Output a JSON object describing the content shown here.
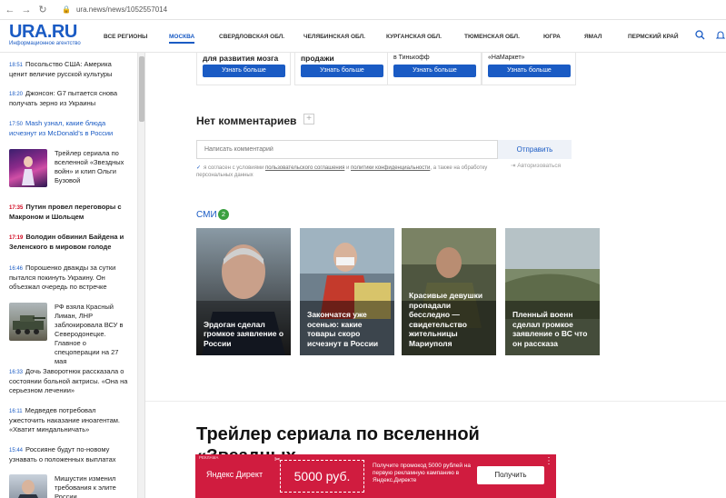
{
  "browser": {
    "url": "ura.news/news/1052557014"
  },
  "header": {
    "logo": "URA.RU",
    "logo_sub": "Информационное агентство",
    "nav": [
      "ВСЕ РЕГИОНЫ",
      "МОСКВА",
      "СВЕРДЛОВСКАЯ ОБЛ.",
      "ЧЕЛЯБИНСКАЯ ОБЛ.",
      "КУРГАНСКАЯ ОБЛ.",
      "ТЮМЕНСКАЯ ОБЛ.",
      "ЮГРА",
      "ЯМАЛ",
      "ПЕРМСКИЙ КРАЙ"
    ],
    "active_nav": "МОСКВА"
  },
  "sidebar": {
    "news": [
      {
        "time": "18:51",
        "text": "Посольство США: Америка ценит величие русской культуры"
      },
      {
        "time": "18:20",
        "text": "Джонсон: G7 пытается снова получать зерно из Украины"
      },
      {
        "time": "17:50",
        "text": "Mash узнал, какие блюда исчезнут из McDonald’s в России"
      },
      {
        "time": "",
        "text": "Трейлер сериала по вселенной «Звездных войн» и клип Ольги Бузовой"
      },
      {
        "time": "17:35",
        "text": "Путин провел переговоры с Макроном и Шольцем"
      },
      {
        "time": "17:19",
        "text": "Володин обвинил Байдена и Зеленского в мировом голоде"
      },
      {
        "time": "16:46",
        "text": "Порошенко дважды за сутки пытался покинуть Украину. Он объезжал очередь по встречке"
      },
      {
        "time": "",
        "text": "РФ взяла Красный Лиман, ЛНР заблокировала ВСУ в Северодонецке. Главное о спецоперации на 27 мая"
      },
      {
        "time": "16:33",
        "text": "Дочь Заворотнюк рассказала о состоянии больной актрисы. «Она на серьезном лечении»"
      },
      {
        "time": "16:11",
        "text": "Медведев потребовал ужесточить наказание иноагентам. «Хватит миндальничать»"
      },
      {
        "time": "15:44",
        "text": "Россияне будут по-новому узнавать о положенных выплатах"
      },
      {
        "time": "",
        "text": "Мишустин изменил требования к элите России"
      }
    ]
  },
  "promo": [
    {
      "text": "для развития мозга",
      "button": "Узнать больше"
    },
    {
      "text": "продажи",
      "button": "Узнать больше"
    },
    {
      "text": "в Тинькофф",
      "button": "Узнать больше"
    },
    {
      "text": "«НаМаркет»",
      "button": "Узнать больше"
    }
  ],
  "comments": {
    "title": "Нет комментариев",
    "placeholder": "Написать комментарий",
    "send": "Отправить",
    "consent_pre": "я согласен с условиями ",
    "consent_link1": "пользовательского соглашения",
    "consent_mid": " и ",
    "consent_link2": "политики конфиденциальности",
    "consent_post": ", а также на обработку персональных данных",
    "auth": "Авторизоваться"
  },
  "smi": {
    "title": "СМИ",
    "count": "2",
    "cards": [
      {
        "caption": "Эрдоган сделал громкое заявление о России"
      },
      {
        "caption": "Закончатся уже осенью: какие товары скоро исчезнут в России"
      },
      {
        "caption": "Красивые девушки пропадали бесследно — свидетельство жительницы Мариуполя"
      },
      {
        "caption": "Пленный военн сделал громкое заявление о ВС что он рассказа"
      }
    ]
  },
  "article": {
    "title": "Трейлер сериала по вселенной «Звездных"
  },
  "ad": {
    "label": "РЕКЛАМА",
    "brand": "Яндекс Директ",
    "amount": "5000 руб.",
    "text": "Получите промокод 5000 рублей на первую рекламную кампанию в Яндекс.Директе",
    "button": "Получить"
  }
}
